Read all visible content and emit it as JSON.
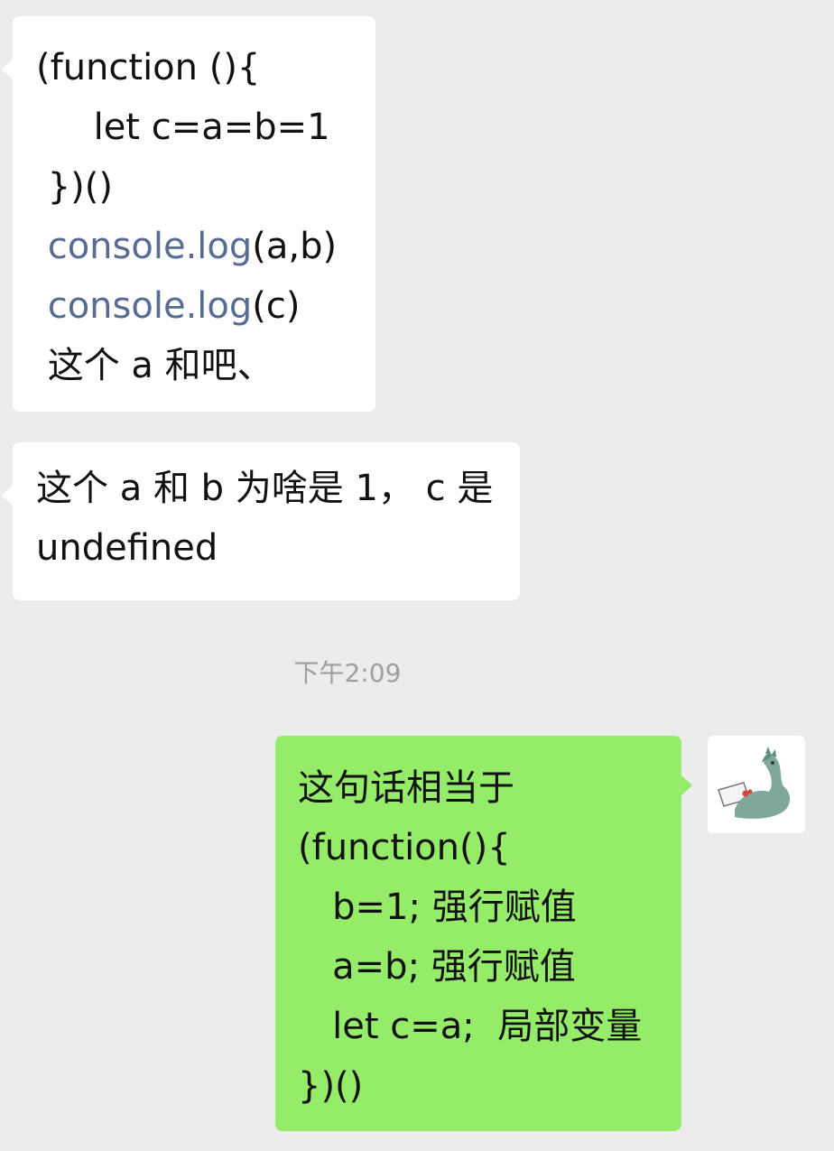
{
  "messages": [
    {
      "direction": "incoming",
      "lines": [
        "(function (){",
        "     let c=a=b=1",
        " })()",
        "console.log(a,b)",
        "console.log(c)",
        " 这个 a 和吧、"
      ],
      "link_parts": {
        "line4_link": "console.log",
        "line4_rest": "(a,b)",
        "line5_link": "console.log",
        "line5_rest": "(c)"
      }
    },
    {
      "direction": "incoming",
      "lines": [
        "这个 a 和 b 为啥是 1， c 是",
        "undefined"
      ]
    },
    {
      "direction": "outgoing",
      "lines": [
        "这句话相当于",
        "(function(){",
        "   b=1; 强行赋值",
        "   a=b; 强行赋值",
        "   let c=a;  局部变量",
        "})()"
      ]
    }
  ],
  "timestamp": "下午2:09",
  "colors": {
    "background": "#ececec",
    "incoming_bubble": "#ffffff",
    "outgoing_bubble": "#95ec69",
    "link": "#576b95",
    "timestamp": "#9e9e9e"
  },
  "avatar": {
    "icon": "dinosaur-avatar-icon"
  }
}
